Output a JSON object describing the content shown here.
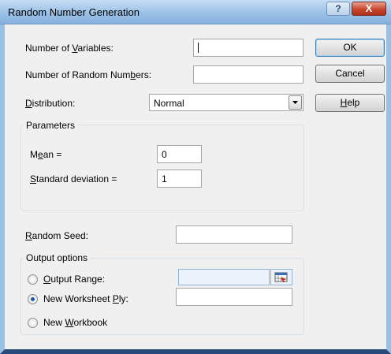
{
  "window": {
    "title": "Random Number Generation"
  },
  "titlebar": {
    "help_glyph": "?",
    "close_glyph": "X"
  },
  "fields": {
    "num_vars": {
      "pre": "Number of ",
      "u": "V",
      "post": "ariables:",
      "value": ""
    },
    "num_rand": {
      "pre": "Number of Random Num",
      "u": "b",
      "post": "ers:",
      "value": ""
    },
    "distribution": {
      "pre": "",
      "u": "D",
      "post": "istribution:",
      "value": "Normal"
    },
    "seed": {
      "pre": "",
      "u": "R",
      "post": "andom Seed:",
      "value": ""
    }
  },
  "buttons": {
    "ok": "OK",
    "cancel": "Cancel",
    "help": {
      "pre": "",
      "u": "H",
      "post": "elp"
    }
  },
  "parameters": {
    "title": "Parameters",
    "mean": {
      "pre": "M",
      "u": "e",
      "post": "an =",
      "value": "0"
    },
    "std": {
      "pre": "",
      "u": "S",
      "post": "tandard deviation =",
      "value": "1"
    }
  },
  "output": {
    "title": "Output options",
    "range": {
      "pre": "",
      "u": "O",
      "post": "utput Range:",
      "value": "",
      "checked": false
    },
    "ply": {
      "pre": "New Worksheet ",
      "u": "P",
      "post": "ly:",
      "value": "",
      "checked": true
    },
    "workbook": {
      "pre": "New ",
      "u": "W",
      "post": "orkbook",
      "checked": false
    }
  },
  "icons": {
    "range_picker": "collapse-dialog-icon",
    "combo_arrow": "chevron-down-icon"
  }
}
